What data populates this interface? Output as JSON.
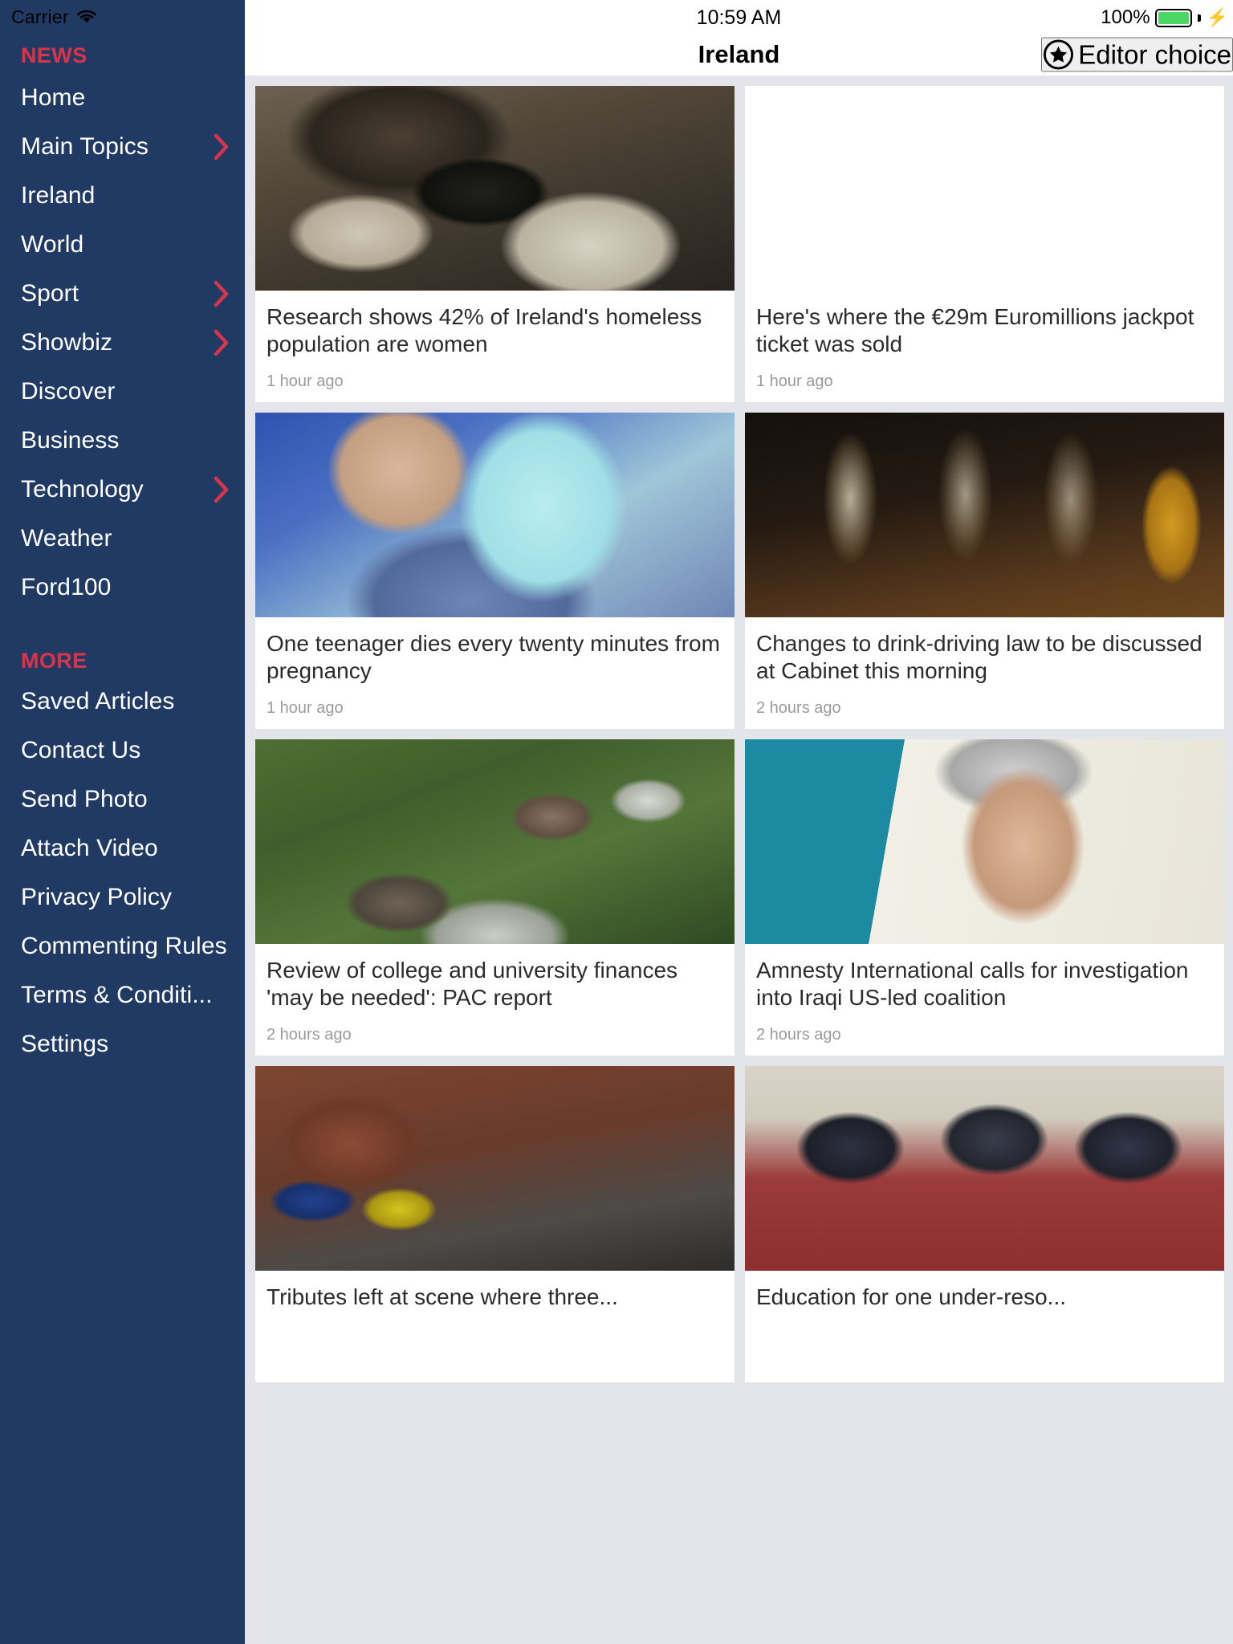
{
  "sidebar": {
    "status": {
      "carrier": "Carrier",
      "wifi_icon": "wifi-icon"
    },
    "news_section_label": "NEWS",
    "more_section_label": "MORE",
    "news_items": [
      {
        "label": "Home",
        "has_chevron": false
      },
      {
        "label": "Main Topics",
        "has_chevron": true
      },
      {
        "label": "Ireland",
        "has_chevron": false
      },
      {
        "label": "World",
        "has_chevron": false
      },
      {
        "label": "Sport",
        "has_chevron": true
      },
      {
        "label": "Showbiz",
        "has_chevron": true
      },
      {
        "label": "Discover",
        "has_chevron": false
      },
      {
        "label": "Business",
        "has_chevron": false
      },
      {
        "label": "Technology",
        "has_chevron": true
      },
      {
        "label": "Weather",
        "has_chevron": false
      },
      {
        "label": "Ford100",
        "has_chevron": false
      }
    ],
    "more_items": [
      {
        "label": "Saved Articles",
        "has_chevron": false
      },
      {
        "label": "Contact Us",
        "has_chevron": false
      },
      {
        "label": "Send Photo",
        "has_chevron": false
      },
      {
        "label": "Attach Video",
        "has_chevron": false
      },
      {
        "label": "Privacy Policy",
        "has_chevron": false
      },
      {
        "label": "Commenting Rules",
        "has_chevron": false
      },
      {
        "label": "Terms & Conditi...",
        "has_chevron": false
      },
      {
        "label": "Settings",
        "has_chevron": false
      }
    ]
  },
  "statusbar": {
    "time": "10:59 AM",
    "battery_percent": "100%",
    "charging_icon": "lightning-bolt-icon"
  },
  "navbar": {
    "title": "Ireland",
    "editor_choice_label": "Editor choice",
    "editor_choice_icon": "star-circle-icon"
  },
  "articles": [
    {
      "title": "Research shows 42% of Ireland's homeless population are women",
      "time": "1 hour ago",
      "photo": "ph-homeless"
    },
    {
      "title": "Here's where the €29m Euromillions jackpot ticket was sold",
      "time": "1 hour ago",
      "photo": "ph-champagne"
    },
    {
      "title": "One teenager dies every twenty minutes from pregnancy",
      "time": "1 hour ago",
      "photo": "ph-pregnancy"
    },
    {
      "title": "Changes to drink-driving law to be discussed at Cabinet this morning",
      "time": "2 hours ago",
      "photo": "ph-pints"
    },
    {
      "title": "Review of college and university finances 'may be needed': PAC report",
      "time": "2 hours ago",
      "photo": "ph-campus"
    },
    {
      "title": "Amnesty International calls for investigation into Iraqi US-led coalition",
      "time": "2 hours ago",
      "photo": "ph-portrait"
    },
    {
      "title": "Tributes left at scene where three...",
      "time": "",
      "photo": "ph-flats"
    },
    {
      "title": "Education for one under-reso...",
      "time": "",
      "photo": "ph-classroom"
    }
  ],
  "colors": {
    "sidebar_bg": "#213a63",
    "accent_red": "#d8344a",
    "page_bg": "#e3e5ea",
    "card_bg": "#ffffff",
    "battery_green": "#4cd764"
  }
}
